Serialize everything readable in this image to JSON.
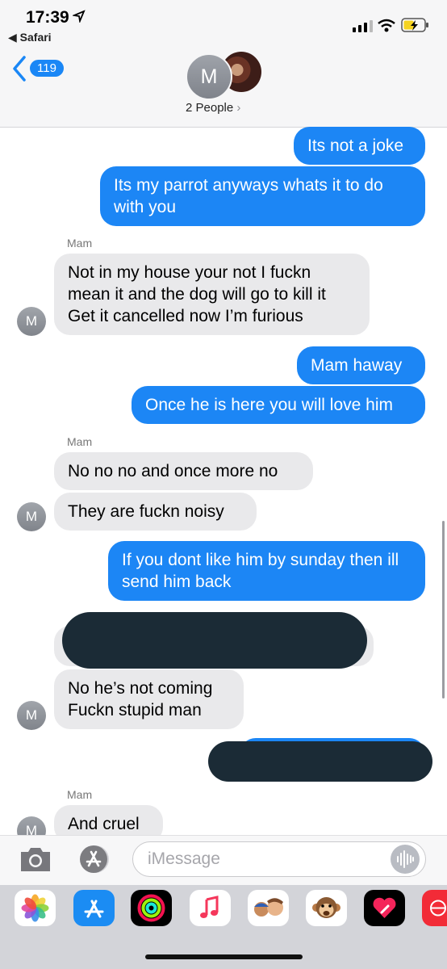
{
  "status_bar": {
    "time": "17:39",
    "back_app": "◀ Safari"
  },
  "header": {
    "back_count": "119",
    "avatar_initial": "M",
    "group_label": "2 People",
    "group_chevron": "›"
  },
  "messages": [
    {
      "text": "Its not a joke"
    },
    {
      "text": "Its my parrot anyways whats it to do with you"
    },
    {
      "sender": "Mam"
    },
    {
      "text": "Not in my house your not I fuckn mean it and the dog will go to kill it Get it cancelled now I’m furious",
      "avatar": "M"
    },
    {
      "text": "Mam haway"
    },
    {
      "text": "Once he is here you will love him"
    },
    {
      "sender": "Mam"
    },
    {
      "text": "No no no and once more no"
    },
    {
      "text": "They are fuckn noisy",
      "avatar": "M"
    },
    {
      "text": "If you dont like him by sunday then ill send him back"
    },
    {
      "text": "No he’s not coming Fuckn stupid man",
      "avatar": "M"
    },
    {
      "sender": "Mam"
    },
    {
      "text": "And cruel",
      "avatar": "M"
    }
  ],
  "input": {
    "placeholder": "iMessage"
  },
  "apps": [
    "photos-icon",
    "app-store-icon",
    "activity-icon",
    "music-icon",
    "memoji-icon",
    "animoji-icon",
    "digital-touch-icon",
    "web-icon"
  ],
  "colors": {
    "outgoing": "#1c86f5",
    "incoming": "#e9e9eb",
    "accent": "#1a87f6"
  }
}
